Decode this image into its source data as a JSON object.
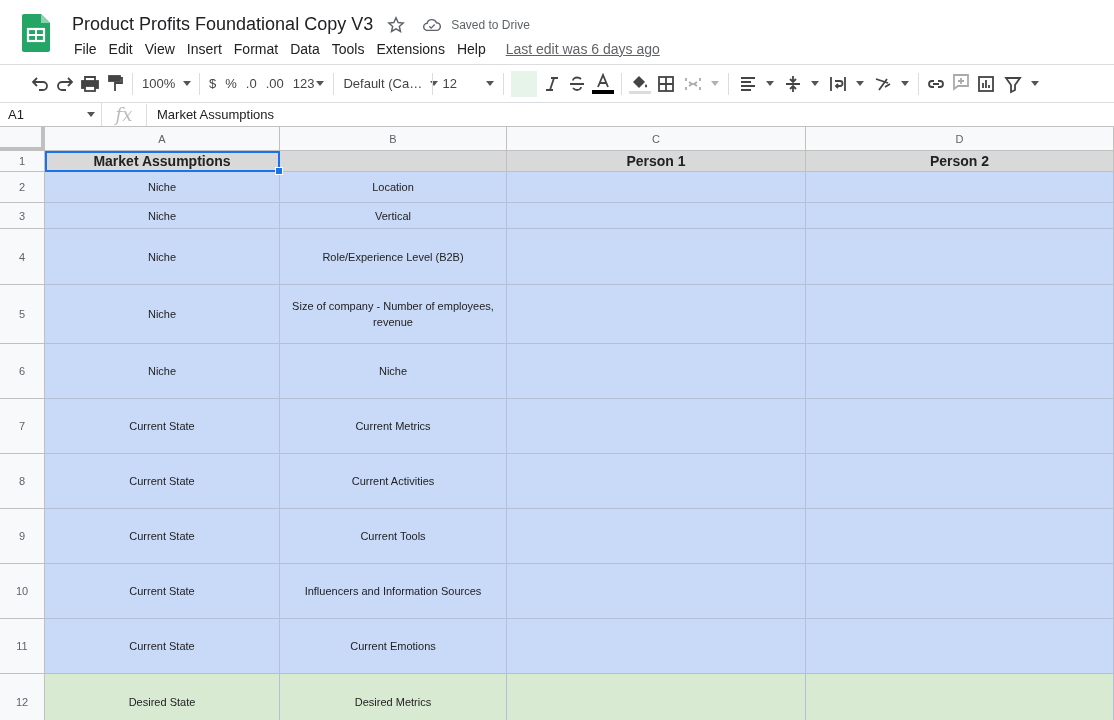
{
  "document": {
    "title": "Product Profits Foundational Copy V3",
    "starred": false,
    "save_status": "Saved to Drive",
    "last_edit": "Last edit was 6 days ago"
  },
  "menu": [
    "File",
    "Edit",
    "View",
    "Insert",
    "Format",
    "Data",
    "Tools",
    "Extensions",
    "Help"
  ],
  "toolbar": {
    "zoom": "100%",
    "currency": "$",
    "percent": "%",
    "decrease_decimals": ".0",
    "increase_decimals": ".00",
    "more_formats": "123",
    "font": "Default (Ca…",
    "font_size": "12"
  },
  "formula_bar": {
    "cell_ref": "A1",
    "fx": "fx",
    "value": "Market Assumptions"
  },
  "columns": [
    "A",
    "B",
    "C",
    "D"
  ],
  "rows": [
    {
      "number": "1",
      "kind": "header",
      "color": "#d9d9d9",
      "cells": [
        {
          "text": "Market Assumptions",
          "selected": true
        },
        {
          "selected": false
        },
        {
          "text": "Person 1",
          "selected": false
        },
        {
          "text": "Person 2",
          "selected": false
        }
      ]
    },
    {
      "number": "2",
      "kind": "body",
      "color": "#c9daf8",
      "cells": [
        {
          "text": "Niche",
          "selected": false
        },
        {
          "text": "Location",
          "selected": false
        },
        {
          "selected": false
        },
        {
          "selected": false
        }
      ]
    },
    {
      "number": "3",
      "kind": "body",
      "color": "#c9daf8",
      "cells": [
        {
          "text": "Niche",
          "selected": false
        },
        {
          "text": "Vertical",
          "selected": false
        },
        {
          "selected": false
        },
        {
          "selected": false
        }
      ]
    },
    {
      "number": "4",
      "kind": "body",
      "color": "#c9daf8",
      "cells": [
        {
          "text": "Niche",
          "selected": false
        },
        {
          "text": "Role/Experience Level (B2B)",
          "selected": false
        },
        {
          "selected": false
        },
        {
          "selected": false
        }
      ]
    },
    {
      "number": "5",
      "kind": "body",
      "color": "#c9daf8",
      "cells": [
        {
          "text": "Niche",
          "selected": false
        },
        {
          "text": "Size of company - Number of employees, revenue",
          "selected": false
        },
        {
          "selected": false
        },
        {
          "selected": false
        }
      ]
    },
    {
      "number": "6",
      "kind": "body",
      "color": "#c9daf8",
      "cells": [
        {
          "text": "Niche",
          "selected": false
        },
        {
          "text": "Niche",
          "selected": false
        },
        {
          "selected": false
        },
        {
          "selected": false
        }
      ]
    },
    {
      "number": "7",
      "kind": "body",
      "color": "#c9daf8",
      "cells": [
        {
          "text": "Current State",
          "selected": false
        },
        {
          "text": "Current Metrics",
          "selected": false
        },
        {
          "selected": false
        },
        {
          "selected": false
        }
      ]
    },
    {
      "number": "8",
      "kind": "body",
      "color": "#c9daf8",
      "cells": [
        {
          "text": "Current State",
          "selected": false
        },
        {
          "text": "Current Activities",
          "selected": false
        },
        {
          "selected": false
        },
        {
          "selected": false
        }
      ]
    },
    {
      "number": "9",
      "kind": "body",
      "color": "#c9daf8",
      "cells": [
        {
          "text": "Current State",
          "selected": false
        },
        {
          "text": "Current Tools",
          "selected": false
        },
        {
          "selected": false
        },
        {
          "selected": false
        }
      ]
    },
    {
      "number": "10",
      "kind": "body",
      "color": "#c9daf8",
      "cells": [
        {
          "text": "Current State",
          "selected": false
        },
        {
          "text": "Influencers and Information Sources",
          "selected": false
        },
        {
          "selected": false
        },
        {
          "selected": false
        }
      ]
    },
    {
      "number": "11",
      "kind": "body",
      "color": "#c9daf8",
      "cells": [
        {
          "text": "Current State",
          "selected": false
        },
        {
          "text": "Current Emotions",
          "selected": false
        },
        {
          "selected": false
        },
        {
          "selected": false
        }
      ]
    },
    {
      "number": "12",
      "kind": "body",
      "color": "#d9ead3",
      "cells": [
        {
          "text": "Desired State",
          "selected": false
        },
        {
          "text": "Desired Metrics",
          "selected": false
        },
        {
          "selected": false
        },
        {
          "selected": false
        }
      ]
    }
  ]
}
